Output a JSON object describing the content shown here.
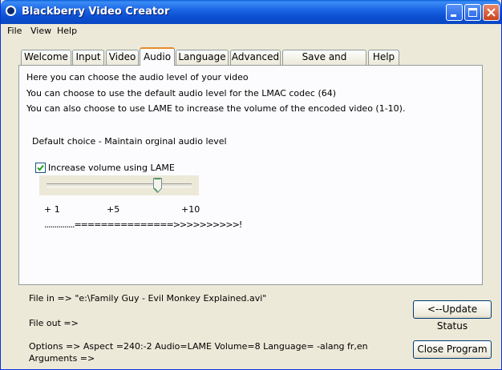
{
  "window": {
    "title": "Blackberry Video Creator"
  },
  "menu": {
    "items": [
      "File",
      "View",
      "Help"
    ]
  },
  "tabs": [
    {
      "label": "Welcome"
    },
    {
      "label": "Input"
    },
    {
      "label": "Video"
    },
    {
      "label": "Audio",
      "active": true
    },
    {
      "label": "Language"
    },
    {
      "label": "Advanced"
    },
    {
      "label": "Save and Encode"
    },
    {
      "label": "Help"
    }
  ],
  "audio": {
    "intro1": "Here you can choose the audio level of your video",
    "intro2": "You can choose to use the default audio level for the LMAC codec (64)",
    "intro3": "You can also choose to use LAME to increase the volume of the encoded video (1-10).",
    "default_choice": "Default choice - Maintain orginal audio level",
    "lame_checkbox_label": "Increase volume using LAME",
    "lame_checked": true,
    "slider": {
      "min": 1,
      "max": 10,
      "value": 8
    },
    "scale_labels": [
      "+ 1",
      "+5",
      "+10"
    ],
    "scale_bar": "...............===============>>>>>>>>>>!"
  },
  "status": {
    "file_in": "File in =>  \"e:\\Family Guy - Evil Monkey Explained.avi\"",
    "file_out": "File out =>",
    "options": "Options =>  Aspect =240:-2   Audio=LAME   Volume=8    Language= -alang fr,en",
    "arguments": "Arguments =>"
  },
  "buttons": {
    "update_status": "<--Update Status",
    "close_program": "Close Program"
  },
  "colors": {
    "title_blue": "#0b4fd1",
    "tab_accent": "#e68b2c",
    "face": "#ece9d8"
  }
}
